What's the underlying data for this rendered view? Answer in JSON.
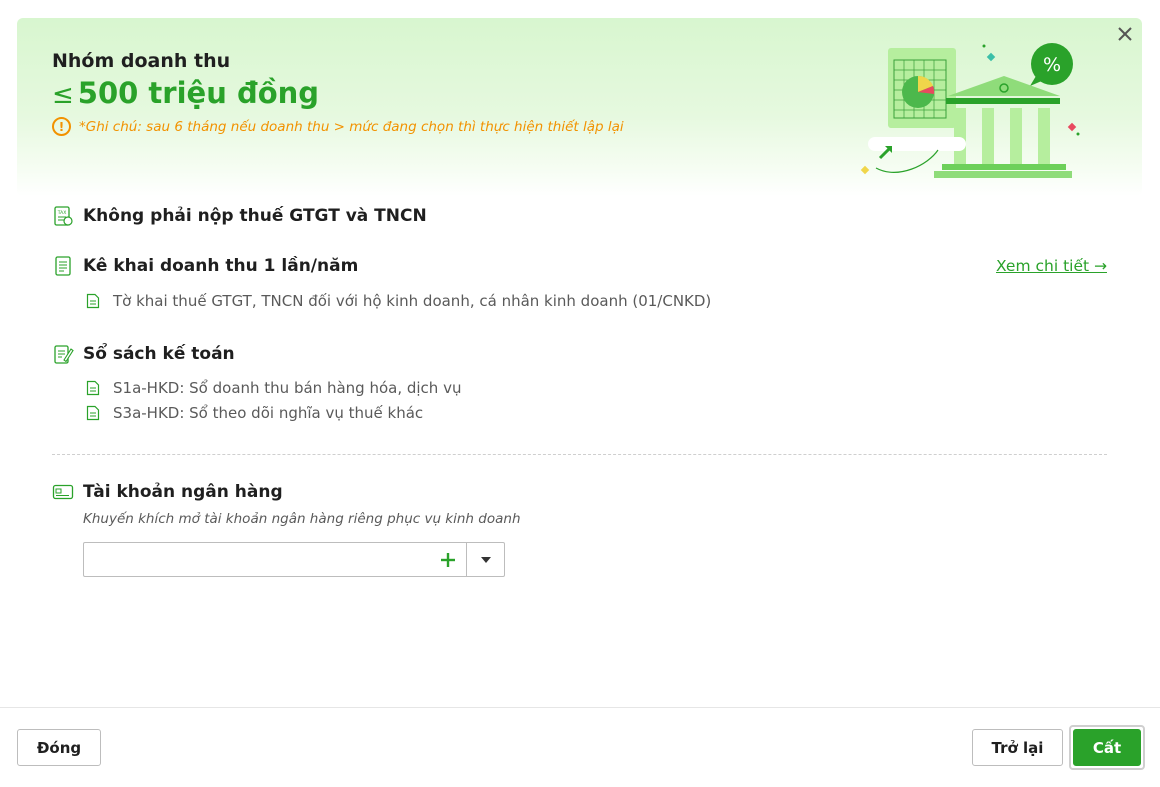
{
  "header": {
    "title": "Nhóm doanh thu",
    "amount_symbol": "≤",
    "amount": "500 triệu đồng",
    "note_icon": "!",
    "note": "*Ghi chú: sau 6 tháng nếu doanh thu > mức đang chọn thì thực hiện thiết lập lại"
  },
  "sections": {
    "tax": {
      "title": "Không phải nộp thuế GTGT và TNCN",
      "icon": "tax-document-icon"
    },
    "declare": {
      "title": "Kê khai doanh thu 1 lần/năm",
      "icon": "declaration-list-icon",
      "link": "Xem chi tiết →",
      "items": [
        "Tờ khai thuế GTGT, TNCN đối với hộ kinh doanh, cá nhân kinh doanh (01/CNKD)"
      ]
    },
    "books": {
      "title": "Sổ sách kế toán",
      "icon": "ledger-pen-icon",
      "items": [
        "S1a-HKD: Sổ doanh thu bán hàng hóa, dịch vụ",
        "S3a-HKD: Sổ theo dõi nghĩa vụ thuế khác"
      ]
    },
    "bank": {
      "title": "Tài khoản ngân hàng",
      "icon": "bank-card-icon",
      "hint": "Khuyến khích mở tài khoản ngân hàng riêng phục vụ kinh doanh",
      "value": ""
    }
  },
  "footer": {
    "close_label": "Đóng",
    "back_label": "Trở lại",
    "save_label": "Cất"
  },
  "colors": {
    "accent": "#2aa22a",
    "warning": "#f29200",
    "banner_bg": "#d8f6cf"
  }
}
